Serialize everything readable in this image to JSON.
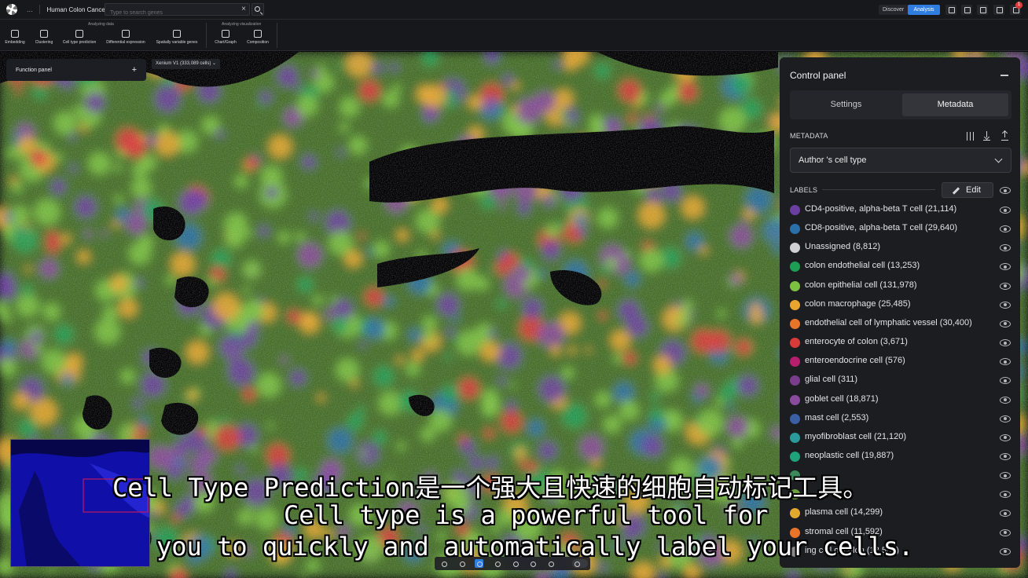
{
  "topbar": {
    "breadcrumb_dots": "...",
    "project_title": "Human Colon Cancer",
    "search_placeholder": "Type to search genes",
    "discover_label": "Discover",
    "analysis_label": "Analysis",
    "notification_count": "1"
  },
  "toolbar": {
    "group_analyzing_data": "Analyzing data",
    "group_analyzing_visualization": "Analyzing visualization",
    "tools": [
      "Embedding",
      "Clustering",
      "Cell type prediction",
      "Differential expression",
      "Spatially variable genes",
      "Chart/Graph",
      "Composition"
    ]
  },
  "canvas": {
    "function_panel_label": "Function panel",
    "function_panel_add": "+",
    "dataset_label": "Xenium V1 (333,089 cells) ⌄"
  },
  "panel": {
    "title": "Control panel",
    "tabs": [
      "Settings",
      "Metadata"
    ],
    "active_tab": "Metadata",
    "metadata_heading": "METADATA",
    "metadata_selected": "Author 's cell type",
    "labels_heading": "LABELS",
    "edit_label": "Edit",
    "labels": [
      {
        "name": "CD4-positive, alpha-beta T cell (21,114)",
        "color": "#6b3fa0"
      },
      {
        "name": "CD8-positive, alpha-beta T cell (29,640)",
        "color": "#2a6fa8"
      },
      {
        "name": "Unassigned (8,812)",
        "color": "#d0d0d4"
      },
      {
        "name": "colon endothelial cell (13,253)",
        "color": "#1f9d55"
      },
      {
        "name": "colon epithelial cell (131,978)",
        "color": "#7cc242"
      },
      {
        "name": "colon macrophage (25,485)",
        "color": "#e8a630"
      },
      {
        "name": "endothelial cell of lymphatic vessel (30,400)",
        "color": "#e8742a"
      },
      {
        "name": "enterocyte of colon (3,671)",
        "color": "#d93b3b"
      },
      {
        "name": "enteroendocrine cell (576)",
        "color": "#b51f6e"
      },
      {
        "name": "glial cell (311)",
        "color": "#7a3d8c"
      },
      {
        "name": "goblet cell (18,871)",
        "color": "#8a4a9e"
      },
      {
        "name": "mast cell (2,553)",
        "color": "#3a5fa5"
      },
      {
        "name": "myofibroblast cell (21,120)",
        "color": "#2a9a9a"
      },
      {
        "name": "neoplastic cell (19,887)",
        "color": "#1fa37a"
      },
      {
        "name": "",
        "color": "#3a8a5a"
      },
      {
        "name": "",
        "color": "#6aa03a"
      },
      {
        "name": "plasma cell (14,299)",
        "color": "#e3a82e"
      },
      {
        "name": "stromal cell (11,592)",
        "color": "#e8742a"
      },
      {
        "name": "ing cell of colon (12,567)",
        "color": "#888888"
      }
    ]
  },
  "subtitles": {
    "line1": "Cell Type Prediction是一个强大且快速的细胞自动标记工具。",
    "line2": "Cell type is a powerful tool for",
    "line3": "you to quickly and automatically label your cells."
  }
}
